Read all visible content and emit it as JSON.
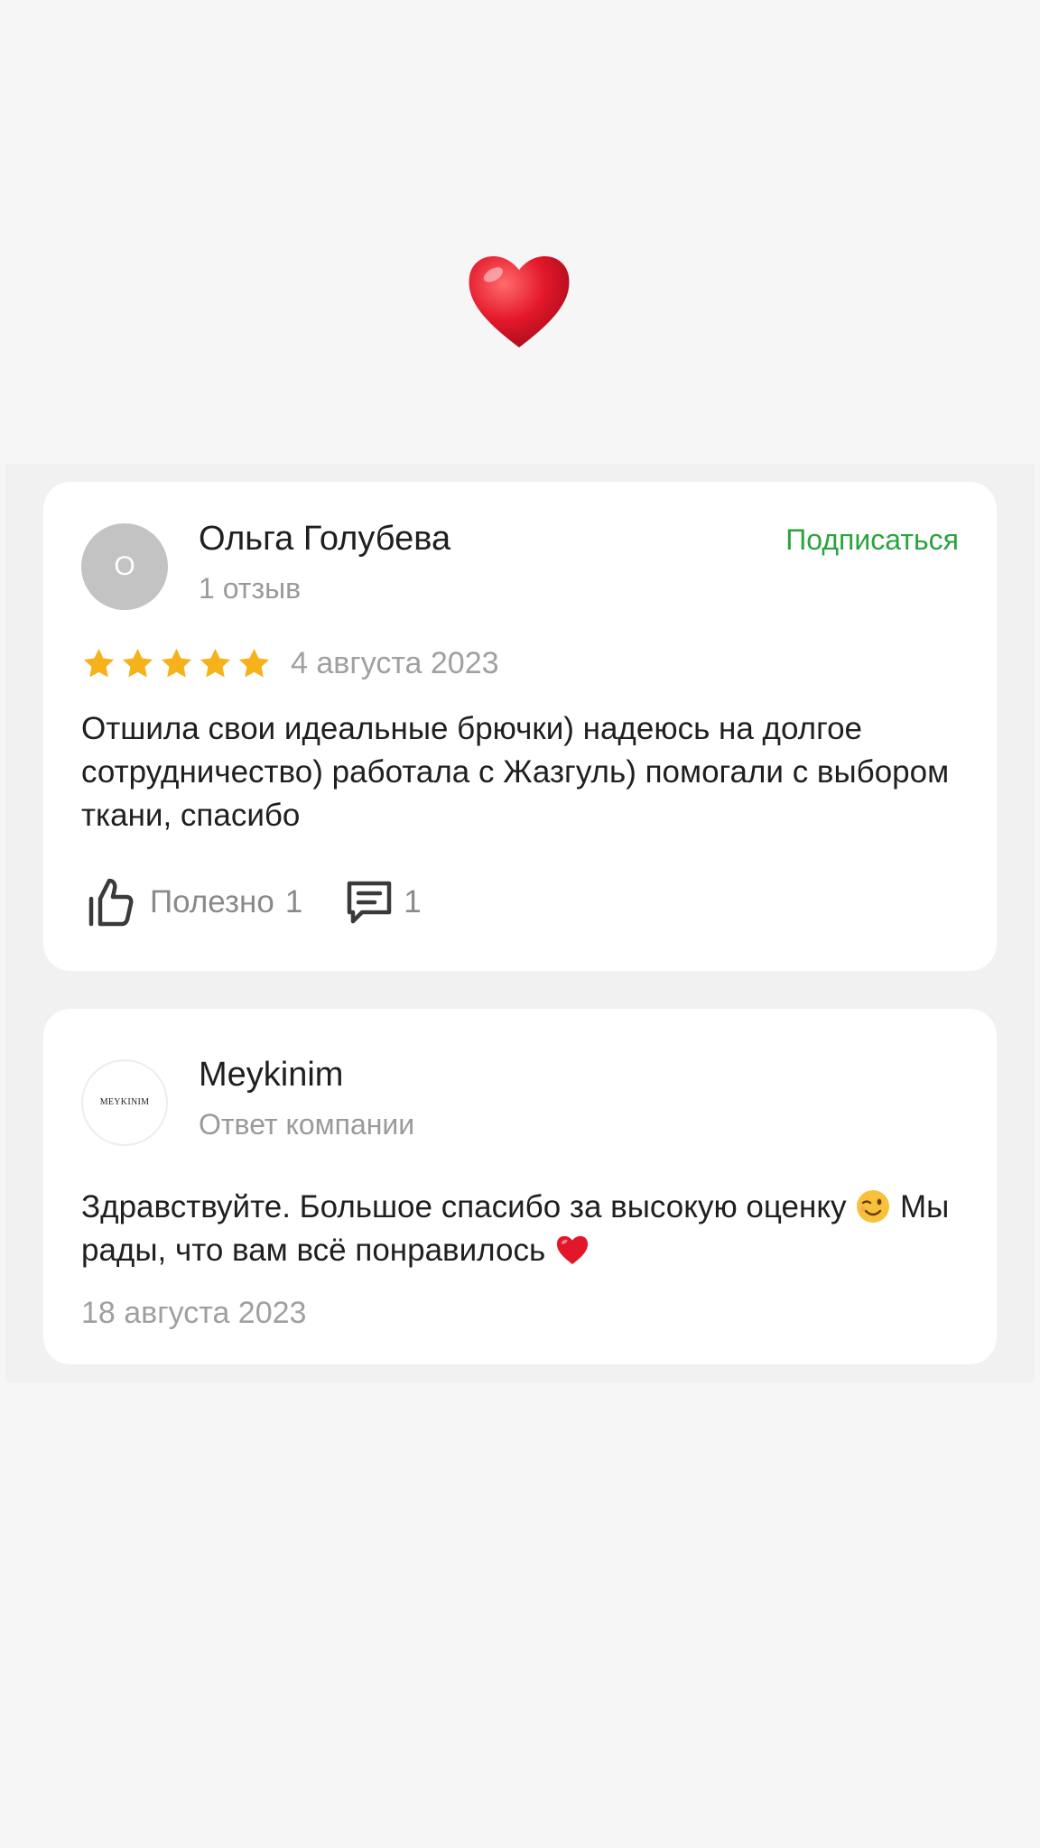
{
  "colors": {
    "page_background": "#f6f6f6",
    "card_background": "#ffffff",
    "accent_green": "#2aa43f",
    "star": "#f6b21a",
    "heart": "#e3172a"
  },
  "top_decoration": {
    "icon": "red-heart-emoji"
  },
  "review": {
    "avatar_letter": "О",
    "author": "Ольга Голубева",
    "author_meta": "1 отзыв",
    "subscribe_label": "Подписаться",
    "rating": 5,
    "rating_max": 5,
    "date": "4 августа 2023",
    "text": "Отшила свои идеальные брючки) надеюсь на долгое сотрудничество) работала с Жазгуль) помогали с выбором ткани, спасибо",
    "helpful_label": "Полезно",
    "helpful_count": "1",
    "comments_count": "1",
    "helpful_icon": "thumbs-up-icon",
    "comments_icon": "comment-icon"
  },
  "reply": {
    "logo_text": "MEYKINIM",
    "company": "Meykinim",
    "company_meta": "Ответ компании",
    "text_part1": "Здравствуйте. Большое спасибо за высокую оценку",
    "text_part2": "Мы рады, что вам всё понравилось",
    "emoji_1": "winking-face-emoji",
    "emoji_2": "red-heart-emoji",
    "date": "18 августа 2023"
  }
}
